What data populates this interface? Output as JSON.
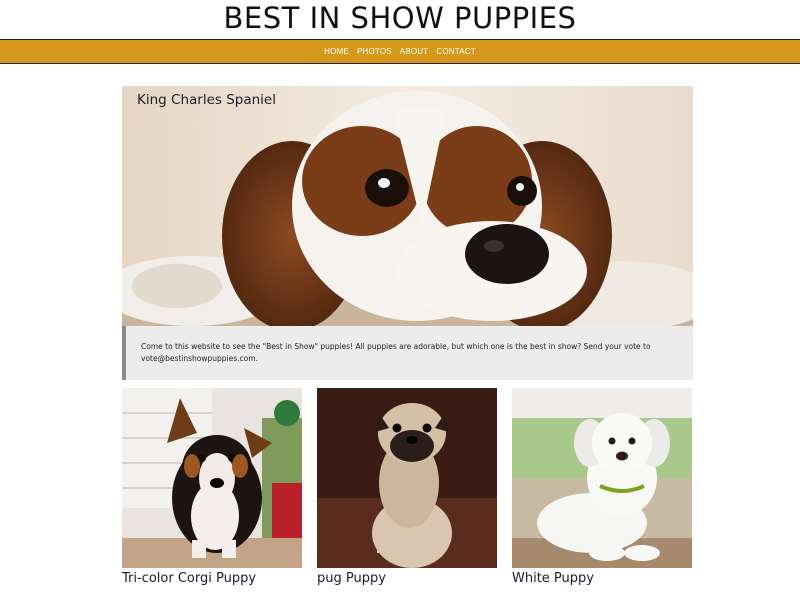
{
  "header": {
    "title": "BEST IN SHOW PUPPIES"
  },
  "nav": {
    "items": [
      {
        "label": "HOME"
      },
      {
        "label": "PHOTOS"
      },
      {
        "label": "ABOUT"
      },
      {
        "label": "CONTACT"
      }
    ],
    "accent_color": "#d4981b"
  },
  "hero": {
    "caption": "King Charles Spaniel",
    "image": "king-charles-spaniel-photo"
  },
  "blurb": {
    "text": "Come to this website to see the \"Best in Show\" puppies! All puppies are adorable, but which one is the best in show? Send your vote to vote@bestinshowpuppies.com."
  },
  "gallery": {
    "cards": [
      {
        "caption": "Tri-color Corgi Puppy",
        "image": "corgi-puppy-photo"
      },
      {
        "caption": "pug Puppy",
        "image": "pug-puppy-photo"
      },
      {
        "caption": "White Puppy",
        "image": "white-puppy-photo"
      }
    ]
  }
}
